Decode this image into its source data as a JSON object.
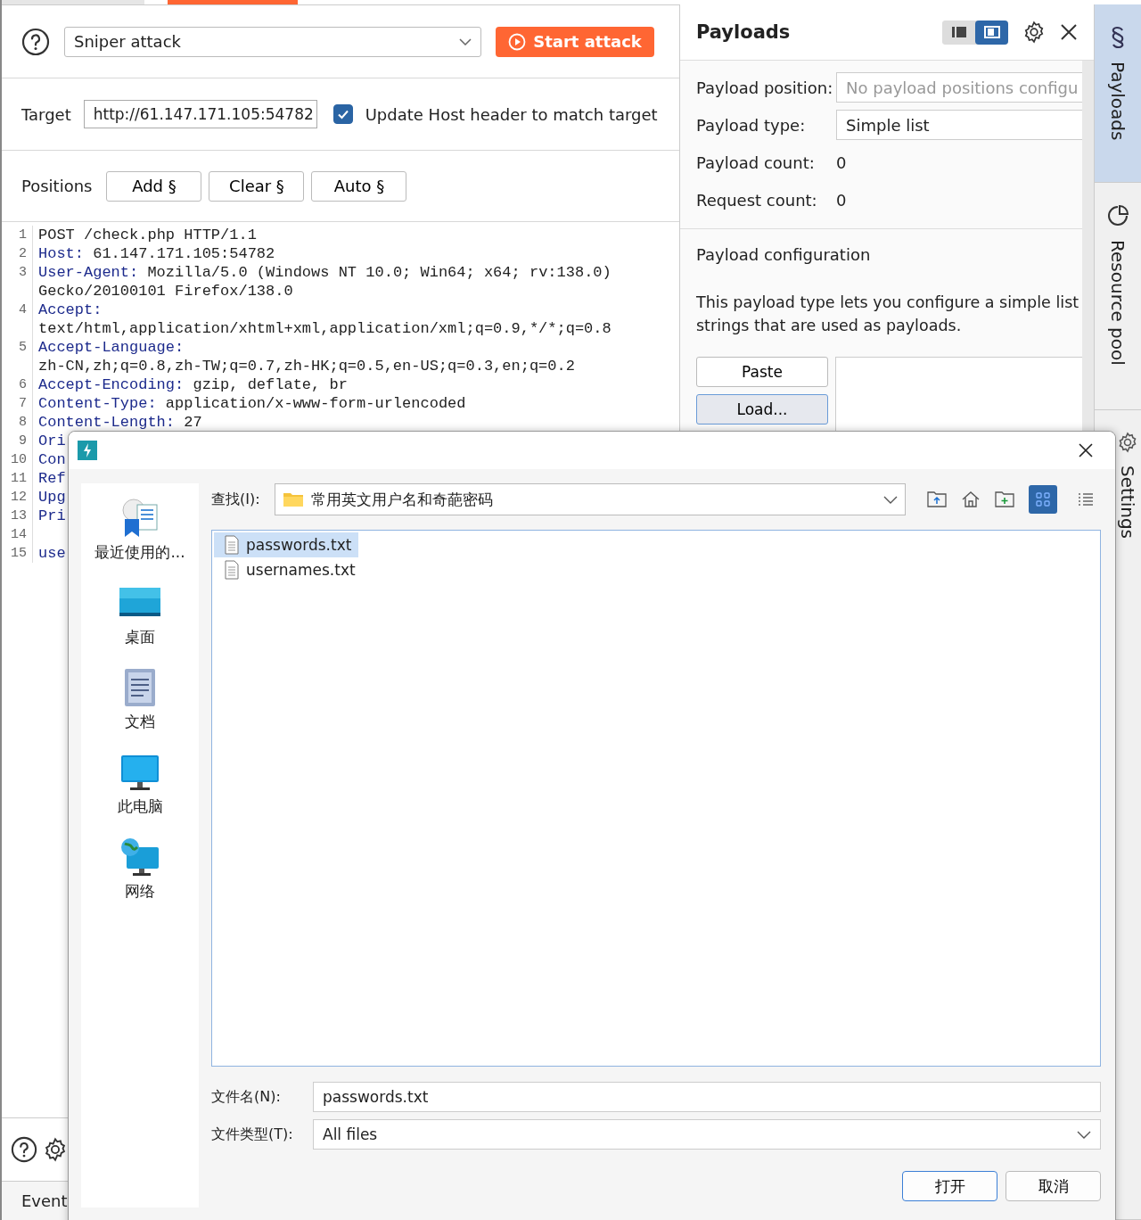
{
  "attack_type": "Sniper attack",
  "start_attack": "Start attack",
  "target": {
    "label": "Target",
    "value": "http://61.147.171.105:54782",
    "update_host": {
      "label": "Update Host header to match target",
      "checked": true
    }
  },
  "positions": {
    "label": "Positions",
    "buttons": [
      "Add §",
      "Clear §",
      "Auto §"
    ]
  },
  "request": [
    {
      "number": "1",
      "value": "POST /check.php HTTP/1.1"
    },
    {
      "number": "2",
      "name": "Host:",
      "value": "61.147.171.105:54782"
    },
    {
      "number": "3",
      "name": "User-Agent:",
      "value": "Mozilla/5.0 (Windows NT 10.0; Win64; x64; rv:138.0) Gecko/20100101 Firefox/138.0"
    },
    {
      "number": "4",
      "name": "Accept:",
      "value": "text/html,application/xhtml+xml,application/xml;q=0.9,*/*;q=0.8"
    },
    {
      "number": "5",
      "name": "Accept-Language:",
      "value": "zh-CN,zh;q=0.8,zh-TW;q=0.7,zh-HK;q=0.5,en-US;q=0.3,en;q=0.2"
    },
    {
      "number": "6",
      "name": "Accept-Encoding:",
      "value": "gzip, deflate, br"
    },
    {
      "number": "7",
      "name": "Content-Type:",
      "value": "application/x-www-form-urlencoded"
    },
    {
      "number": "8",
      "name": "Content-Length:",
      "value": "27"
    },
    {
      "number": "9",
      "name": "Ori"
    },
    {
      "number": "10",
      "name": "Con"
    },
    {
      "number": "11",
      "name": "Ref"
    },
    {
      "number": "12",
      "name": "Upg"
    },
    {
      "number": "13",
      "name": "Pri"
    },
    {
      "number": "14"
    },
    {
      "number": "15",
      "name": "use"
    }
  ],
  "bottom_tab": "Event",
  "payloads": {
    "title": "Payloads",
    "layout_toggle": [
      {
        "selected": false
      },
      {
        "selected": true
      }
    ],
    "fields": [
      {
        "label": "Payload position:",
        "kind": "field",
        "placeholder": "No payload positions configu"
      },
      {
        "label": "Payload type:",
        "kind": "field",
        "value": "Simple list"
      },
      {
        "label": "Payload count:",
        "kind": "text",
        "value": "0"
      },
      {
        "label": "Request count:",
        "kind": "text",
        "value": "0"
      }
    ],
    "configuration_title": "Payload configuration",
    "configuration_text": "This payload type lets you configure a simple list strings that are used as payloads.",
    "buttons": [
      {
        "label": "Paste",
        "focused": false
      },
      {
        "label": "Load...",
        "focused": true
      }
    ]
  },
  "side_tabs": [
    {
      "label": "Payloads",
      "kind": "payloads",
      "selected": true
    },
    {
      "label": "Resource pool",
      "kind": "pool",
      "selected": false
    },
    {
      "label": "Settings",
      "kind": "settings",
      "selected": false
    }
  ],
  "dialog": {
    "look_in_label": "查找(I):",
    "folder": "常用英文用户名和奇葩密码",
    "view_modes": [
      {
        "selected": true
      },
      {
        "selected": false
      }
    ],
    "places": [
      {
        "label": "最近使用的...",
        "kind": "recent"
      },
      {
        "label": "桌面",
        "kind": "desktop"
      },
      {
        "label": "文档",
        "kind": "documents"
      },
      {
        "label": "此电脑",
        "kind": "computer"
      },
      {
        "label": "网络",
        "kind": "network"
      }
    ],
    "files": [
      {
        "name": "passwords.txt",
        "selected": true
      },
      {
        "name": "usernames.txt",
        "selected": false
      }
    ],
    "file_name": {
      "label": "文件名(N):",
      "value": "passwords.txt"
    },
    "file_type": {
      "label": "文件类型(T):",
      "value": "All files"
    },
    "buttons": [
      {
        "label": "打开",
        "default": true
      },
      {
        "label": "取消",
        "default": false
      }
    ]
  }
}
